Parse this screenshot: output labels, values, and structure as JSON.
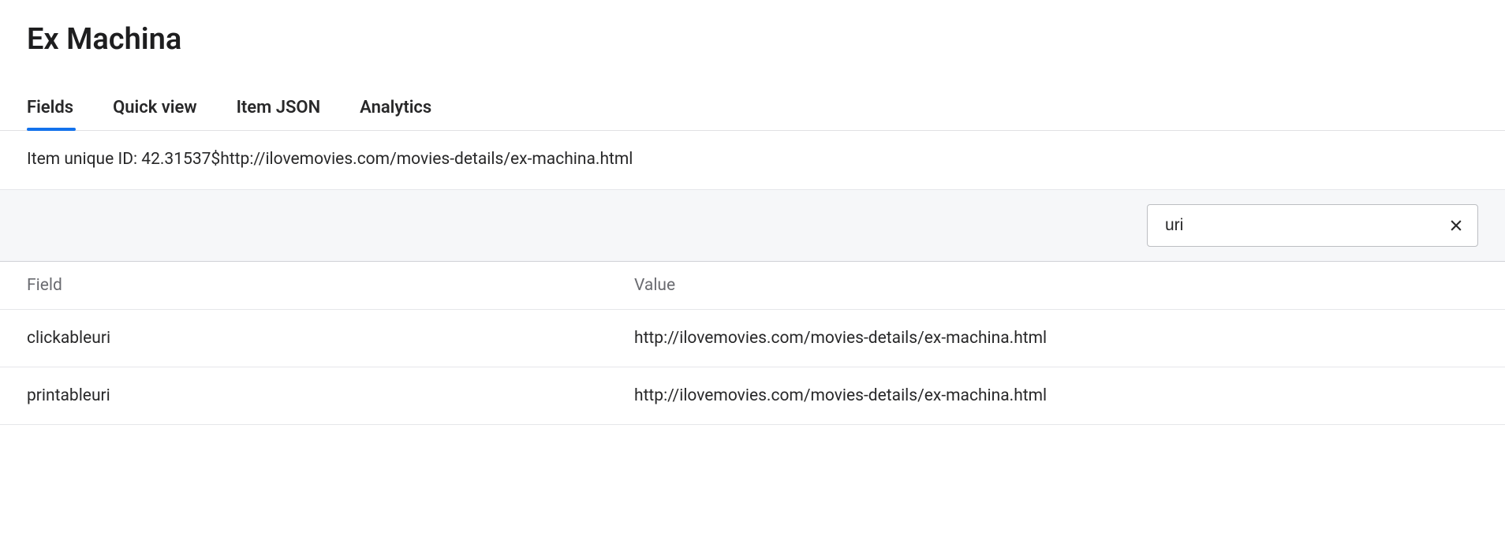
{
  "page_title": "Ex Machina",
  "tabs": [
    {
      "label": "Fields",
      "active": true
    },
    {
      "label": "Quick view",
      "active": false
    },
    {
      "label": "Item JSON",
      "active": false
    },
    {
      "label": "Analytics",
      "active": false
    }
  ],
  "item_id_label": "Item unique ID: ",
  "item_id_value": "42.31537$http://ilovemovies.com/movies-details/ex-machina.html",
  "search": {
    "value": "uri"
  },
  "table": {
    "headers": {
      "field": "Field",
      "value": "Value"
    },
    "rows": [
      {
        "field": "clickableuri",
        "value": "http://ilovemovies.com/movies-details/ex-machina.html"
      },
      {
        "field": "printableuri",
        "value": "http://ilovemovies.com/movies-details/ex-machina.html"
      }
    ]
  }
}
